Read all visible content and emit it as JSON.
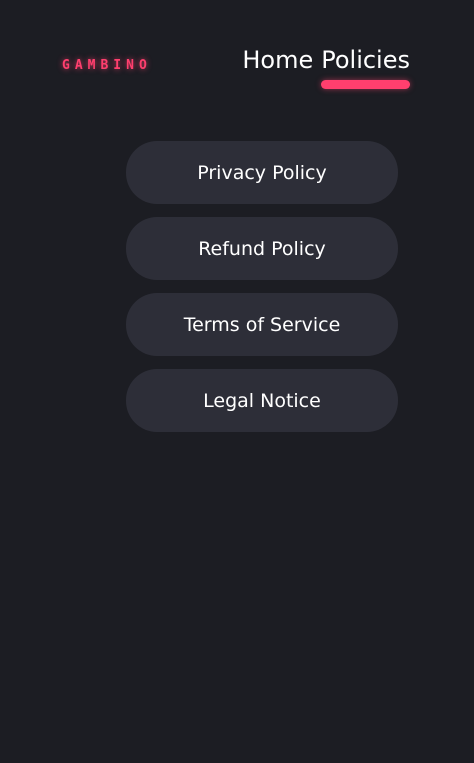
{
  "header": {
    "logo_text": "GAMBINO",
    "nav": [
      {
        "label": "Home",
        "active": false
      },
      {
        "label": "Policies",
        "active": true
      }
    ]
  },
  "policies": [
    {
      "label": "Privacy Policy"
    },
    {
      "label": "Refund Policy"
    },
    {
      "label": "Terms of Service"
    },
    {
      "label": "Legal Notice"
    }
  ],
  "colors": {
    "background": "#1c1d23",
    "button": "#2d2e38",
    "accent": "#ff3f6e",
    "text": "#ffffff"
  }
}
